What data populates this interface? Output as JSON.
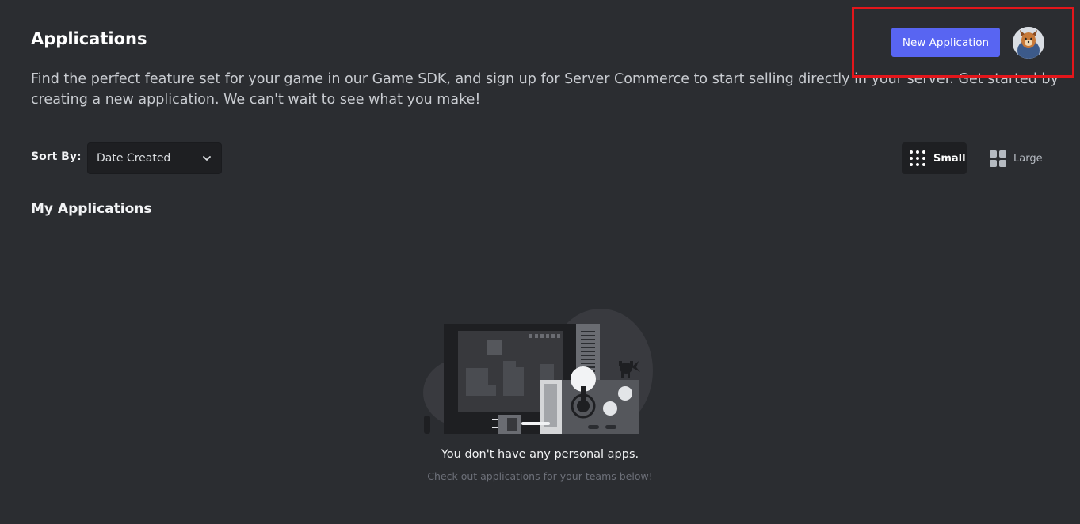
{
  "header": {
    "title": "Applications",
    "description_line1": "Find the perfect feature set for your game in our Game SDK, and sign up for Server Commerce to start selling directly in your server. Get started by",
    "description_line2": "creating a new application. We can't wait to see what you make!",
    "new_application_label": "New Application",
    "avatar_icon": "user-avatar"
  },
  "controls": {
    "sort_label": "Sort By:",
    "sort_value": "Date Created",
    "view_small_label": "Small",
    "view_large_label": "Large",
    "selected_view": "Small"
  },
  "my_applications": {
    "title": "My Applications",
    "empty_title": "You don't have any personal apps.",
    "empty_subtitle": "Check out applications for your teams below!",
    "illustration_icon": "arcade-machine-illustration"
  },
  "colors": {
    "background": "#2b2d31",
    "accent": "#5865f2",
    "highlight": "#e3161b"
  }
}
